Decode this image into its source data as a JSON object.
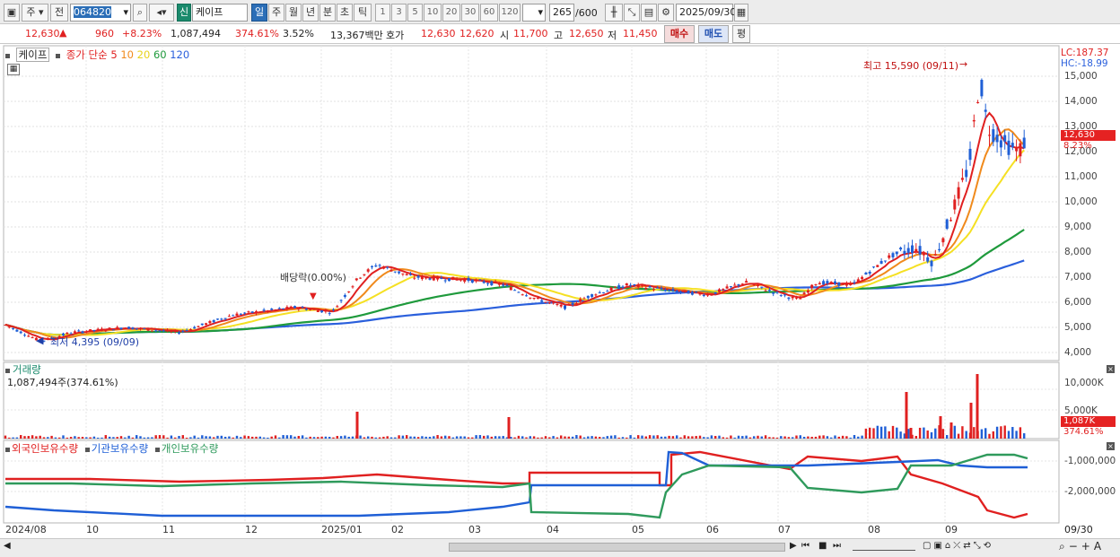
{
  "toolbar": {
    "market": "주",
    "prev": "전",
    "code": "064820",
    "prefix": "신",
    "name": "케이프",
    "periods": [
      "일",
      "주",
      "월",
      "년",
      "분",
      "초",
      "틱"
    ],
    "intervals": [
      "1",
      "3",
      "5",
      "10",
      "20",
      "30",
      "60",
      "120"
    ],
    "count": "265",
    "count_total": "/600",
    "date": "2025/09/30"
  },
  "quote": {
    "price": "12,630",
    "arrow": "▲",
    "change": "960",
    "change_pct": "+8.23%",
    "volume": "1,087,494",
    "vol_ratio": "374.61%",
    "turnover": "3.52%",
    "amount": "13,367백만",
    "hoga_label": "호가",
    "ask": "12,630",
    "bid": "12,620",
    "open_label": "시",
    "open": "11,700",
    "high_label": "고",
    "high": "12,650",
    "low_label": "저",
    "low": "11,450",
    "buy": "매수",
    "sell": "매도",
    "avg": "평"
  },
  "price_pane": {
    "name_tag": "케이프",
    "ma_title": "종가 단순",
    "ma": [
      "5",
      "10",
      "20",
      "60",
      "120"
    ],
    "lc": "LC:187.37",
    "hc": "HC:-18.99",
    "high_note": "최고 15,590 (09/11)",
    "low_note": "최저 4,395 (09/09)",
    "div_note": "배당락(0.00%)",
    "price_tag": "12,630",
    "pct_tag": "8.23%",
    "yticks": [
      "15,000",
      "14,000",
      "13,000",
      "12,000",
      "11,000",
      "10,000",
      "9,000",
      "8,000",
      "7,000",
      "6,000",
      "5,000",
      "4,000"
    ]
  },
  "volume_pane": {
    "title": "거래량",
    "value": "1,087,494주(374.61%)",
    "yticks": [
      "10,000K",
      "5,000K"
    ],
    "tag": "1,087K",
    "pct": "374.61%"
  },
  "holding_pane": {
    "series": [
      "외국인보유수량",
      "기관보유수량",
      "개인보유수량"
    ],
    "yticks": [
      "-1,000,000",
      "-2,000,000"
    ]
  },
  "xaxis": [
    "2024/08",
    "10",
    "11",
    "12",
    "2025/01",
    "02",
    "03",
    "04",
    "05",
    "06",
    "07",
    "08",
    "09"
  ],
  "xaxis_right": "09/30",
  "colors": {
    "up": "#e02020",
    "down": "#1f5fd6",
    "ma5": "#e02020",
    "ma10": "#f08a1c",
    "ma20": "#f5e023",
    "ma60": "#1f9a3c",
    "ma120": "#2a5fdc",
    "foreign": "#e02020",
    "inst": "#1f5fd6",
    "retail": "#2f9a5c"
  }
}
